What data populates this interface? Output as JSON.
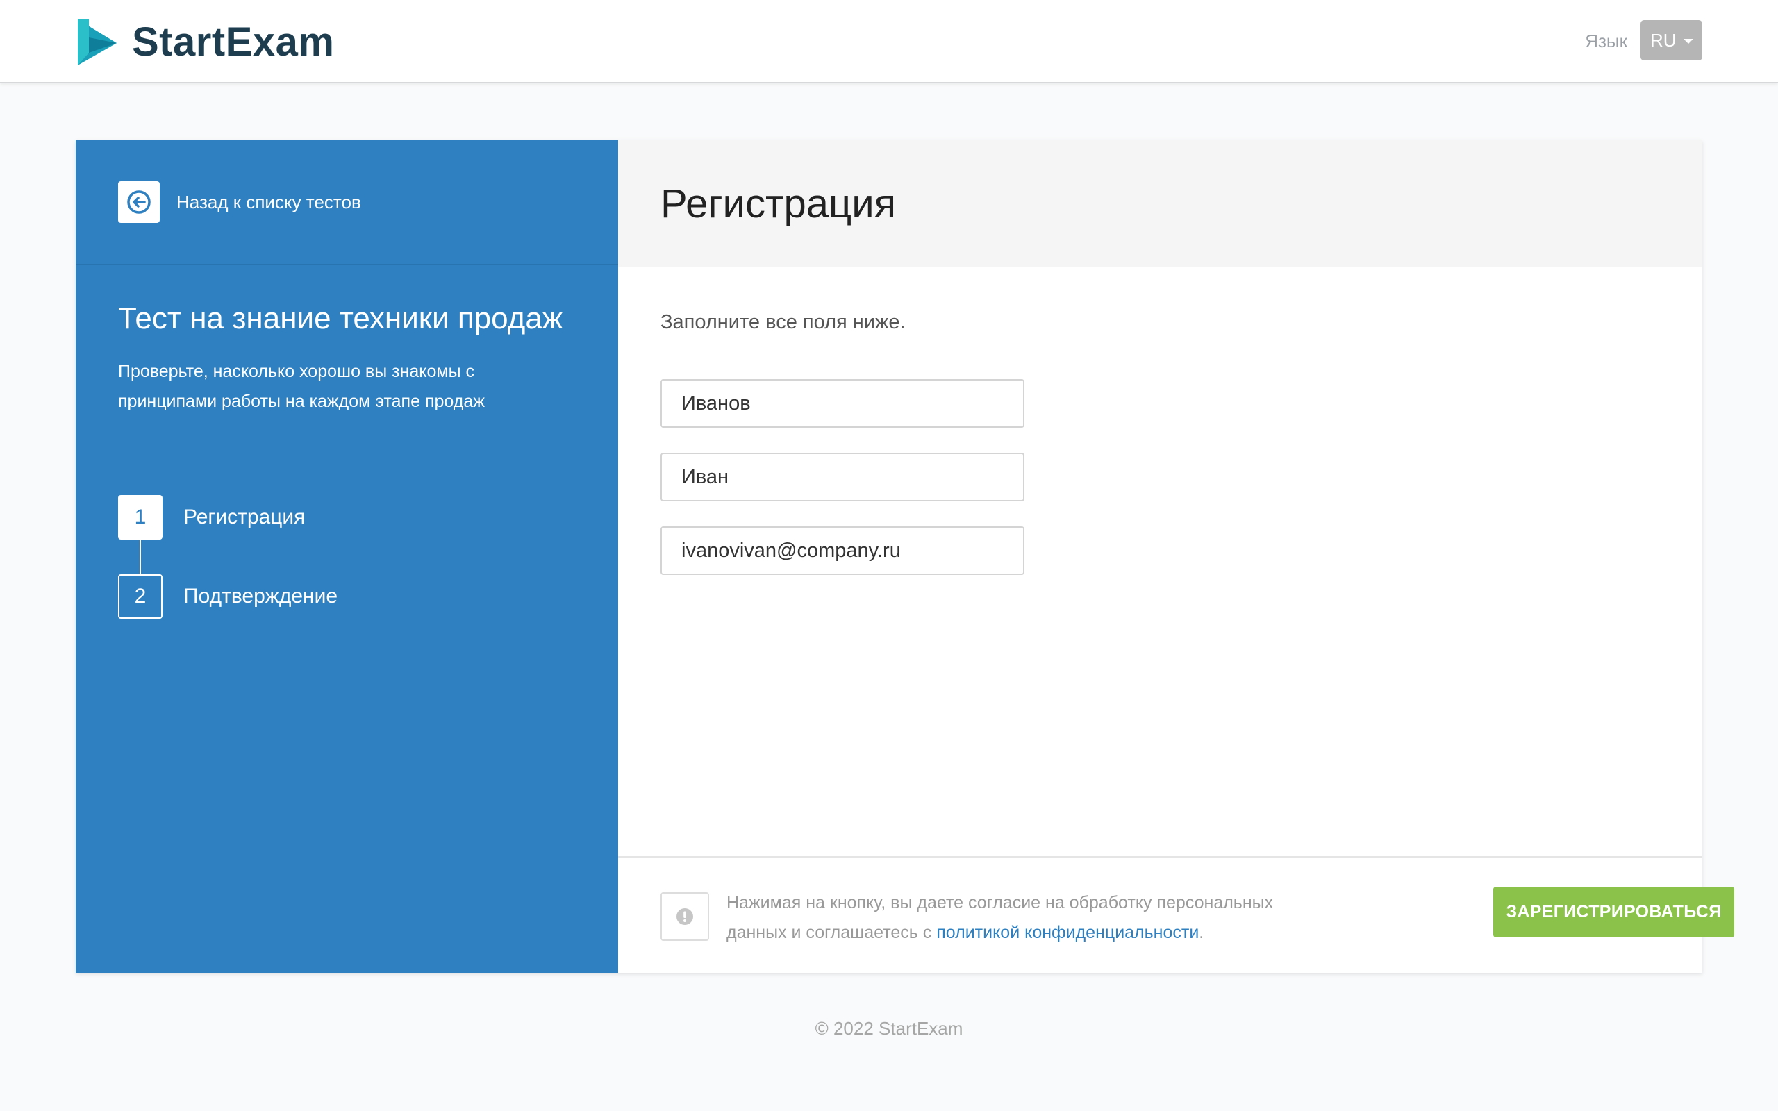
{
  "header": {
    "logo_text": "StartExam",
    "language_label": "Язык",
    "language_value": "RU"
  },
  "sidebar": {
    "back_label": "Назад к списку тестов",
    "test_title": "Тест на знание техники продаж",
    "test_description": "Проверьте, насколько хорошо вы знакомы с принципами работы на каждом этапе продаж",
    "steps": [
      {
        "number": "1",
        "label": "Регистрация",
        "active": true
      },
      {
        "number": "2",
        "label": "Подтверждение",
        "active": false
      }
    ]
  },
  "main": {
    "title": "Регистрация",
    "instruction": "Заполните все поля ниже.",
    "fields": {
      "last_name": "Иванов",
      "first_name": "Иван",
      "email": "ivanovivan@company.ru"
    },
    "consent_text": "Нажимая на кнопку, вы даете согласие на обработку персональных данных и соглашаетесь с",
    "privacy_link": "политикой конфиденциальности",
    "consent_end": ".",
    "submit_label": "ЗАРЕГИСТРИРОВАТЬСЯ"
  },
  "footer": {
    "copyright": "© 2022 StartExam"
  },
  "colors": {
    "brand_blue": "#2e80c1",
    "submit_green": "#8bc34a",
    "logo_teal": "#1aa0b8"
  }
}
